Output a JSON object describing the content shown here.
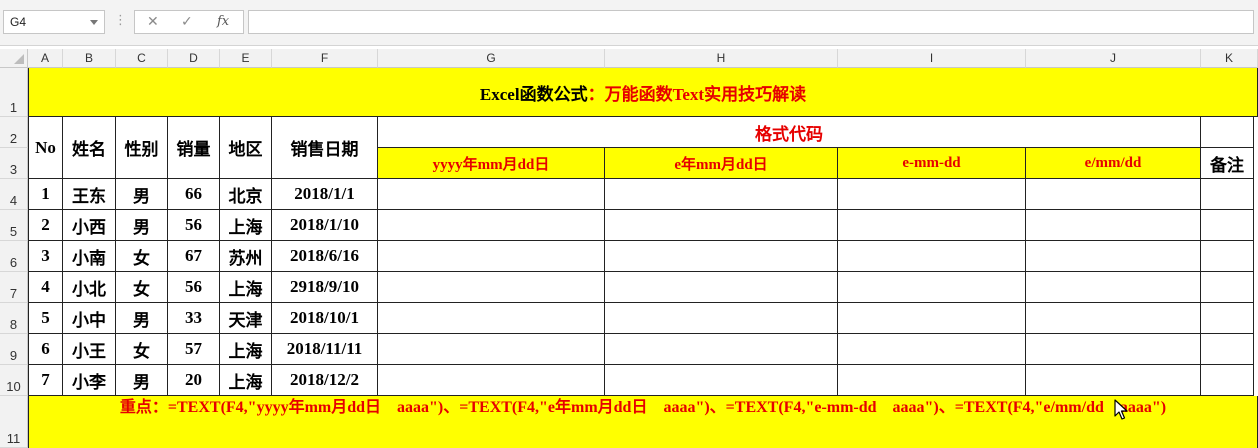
{
  "formula_bar": {
    "name_box": "G4",
    "cancel_icon": "✕",
    "enter_icon": "✓",
    "fx_label": "fx",
    "formula": ""
  },
  "columns": [
    "A",
    "B",
    "C",
    "D",
    "E",
    "F",
    "G",
    "H",
    "I",
    "J",
    "K"
  ],
  "rows": [
    "1",
    "2",
    "3",
    "4",
    "5",
    "6",
    "7",
    "8",
    "9",
    "10",
    "11"
  ],
  "sheet": {
    "title_black": "Excel函数公式",
    "title_red": "：万能函数Text实用技巧解读",
    "headers": {
      "no": "No",
      "name": "姓名",
      "gender": "性别",
      "sales": "销量",
      "region": "地区",
      "date": "销售日期",
      "format_code": "格式代码",
      "remark": "备注"
    },
    "format_headers": [
      "yyyy年mm月dd日",
      "e年mm月dd日",
      "e-mm-dd",
      "e/mm/dd"
    ],
    "data_rows": [
      {
        "no": "1",
        "name": "王东",
        "gender": "男",
        "sales": "66",
        "region": "北京",
        "date": "2018/1/1"
      },
      {
        "no": "2",
        "name": "小西",
        "gender": "男",
        "sales": "56",
        "region": "上海",
        "date": "2018/1/10"
      },
      {
        "no": "3",
        "name": "小南",
        "gender": "女",
        "sales": "67",
        "region": "苏州",
        "date": "2018/6/16"
      },
      {
        "no": "4",
        "name": "小北",
        "gender": "女",
        "sales": "56",
        "region": "上海",
        "date": "2918/9/10"
      },
      {
        "no": "5",
        "name": "小中",
        "gender": "男",
        "sales": "33",
        "region": "天津",
        "date": "2018/10/1"
      },
      {
        "no": "6",
        "name": "小王",
        "gender": "女",
        "sales": "57",
        "region": "上海",
        "date": "2018/11/11"
      },
      {
        "no": "7",
        "name": "小李",
        "gender": "男",
        "sales": "20",
        "region": "上海",
        "date": "2018/12/2"
      }
    ],
    "note": "重点：=TEXT(F4,\"yyyy年mm月dd日　aaaa\")、=TEXT(F4,\"e年mm月dd日　aaaa\")、=TEXT(F4,\"e-mm-dd　aaaa\")、=TEXT(F4,\"e/mm/dd　aaaa\")"
  },
  "colors": {
    "title_fill": "#ffff00",
    "accent_red": "#e60000"
  }
}
